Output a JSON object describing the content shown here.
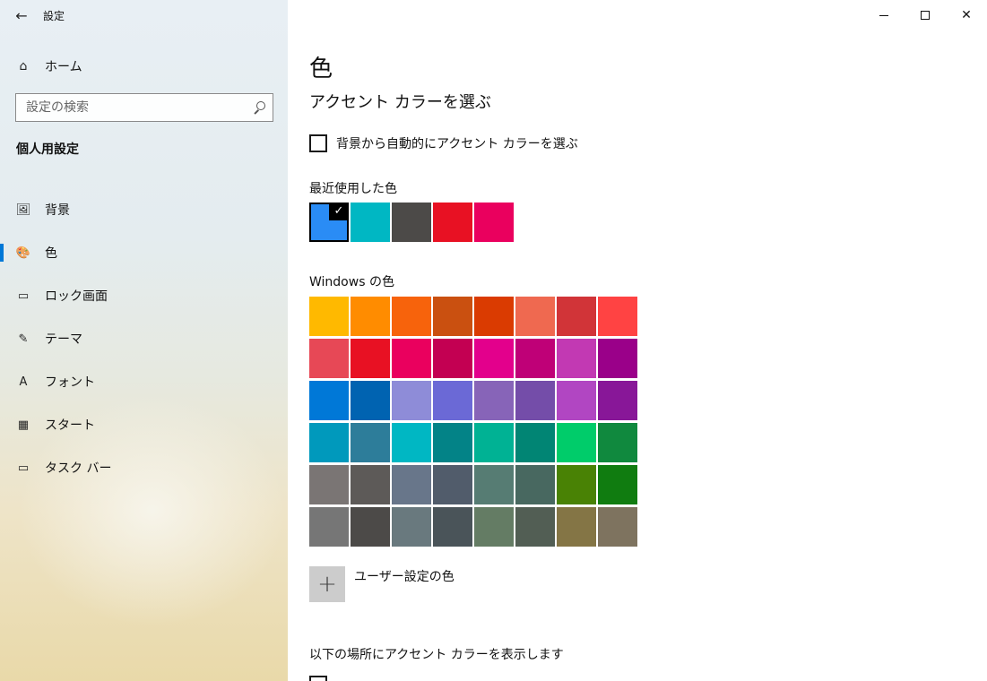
{
  "window": {
    "title": "設定",
    "back_icon": "←",
    "close_icon": "✕"
  },
  "sidebar": {
    "home_label": "ホーム",
    "search_placeholder": "設定の検索",
    "section_title": "個人用設定",
    "items": [
      {
        "label": "背景",
        "icon": "🖼",
        "active": false
      },
      {
        "label": "色",
        "icon": "🎨",
        "active": true
      },
      {
        "label": "ロック画面",
        "icon": "▭",
        "active": false
      },
      {
        "label": "テーマ",
        "icon": "✎",
        "active": false
      },
      {
        "label": "フォント",
        "icon": "A",
        "active": false
      },
      {
        "label": "スタート",
        "icon": "▦",
        "active": false
      },
      {
        "label": "タスク バー",
        "icon": "▭",
        "active": false
      }
    ]
  },
  "main": {
    "title": "色",
    "subtitle": "アクセント カラーを選ぶ",
    "auto_checkbox_label": "背景から自動的にアクセント カラーを選ぶ",
    "auto_checked": false,
    "recent_label": "最近使用した色",
    "recent_colors": [
      "#2a8cf5",
      "#00b7c3",
      "#4c4a48",
      "#e81123",
      "#ea005e"
    ],
    "selected_color": "#2a8cf5",
    "check_glyph": "✓",
    "windows_label": "Windows の色",
    "windows_colors": [
      [
        "#ffb900",
        "#ff8c00",
        "#f7630c",
        "#ca5010",
        "#da3b01",
        "#ef6950",
        "#d13438",
        "#ff4343"
      ],
      [
        "#e74856",
        "#e81123",
        "#ea005e",
        "#c30052",
        "#e3008c",
        "#bf0077",
        "#c239b3",
        "#9a0089"
      ],
      [
        "#0078d7",
        "#0063b1",
        "#8e8cd8",
        "#6b69d6",
        "#8764b8",
        "#744da9",
        "#b146c2",
        "#881798"
      ],
      [
        "#0099bc",
        "#2d7d9a",
        "#00b7c3",
        "#038387",
        "#00b294",
        "#018574",
        "#00cc6a",
        "#10893e"
      ],
      [
        "#7a7574",
        "#5d5a58",
        "#68768a",
        "#515c6b",
        "#567c73",
        "#486860",
        "#498205",
        "#107c10"
      ],
      [
        "#767676",
        "#4c4a48",
        "#69797e",
        "#4a5459",
        "#647c64",
        "#525e54",
        "#847545",
        "#7e735f"
      ]
    ],
    "custom_plus": "+",
    "custom_color_label": "ユーザー設定の色",
    "show_accent_label": "以下の場所にアクセント カラーを表示します"
  }
}
